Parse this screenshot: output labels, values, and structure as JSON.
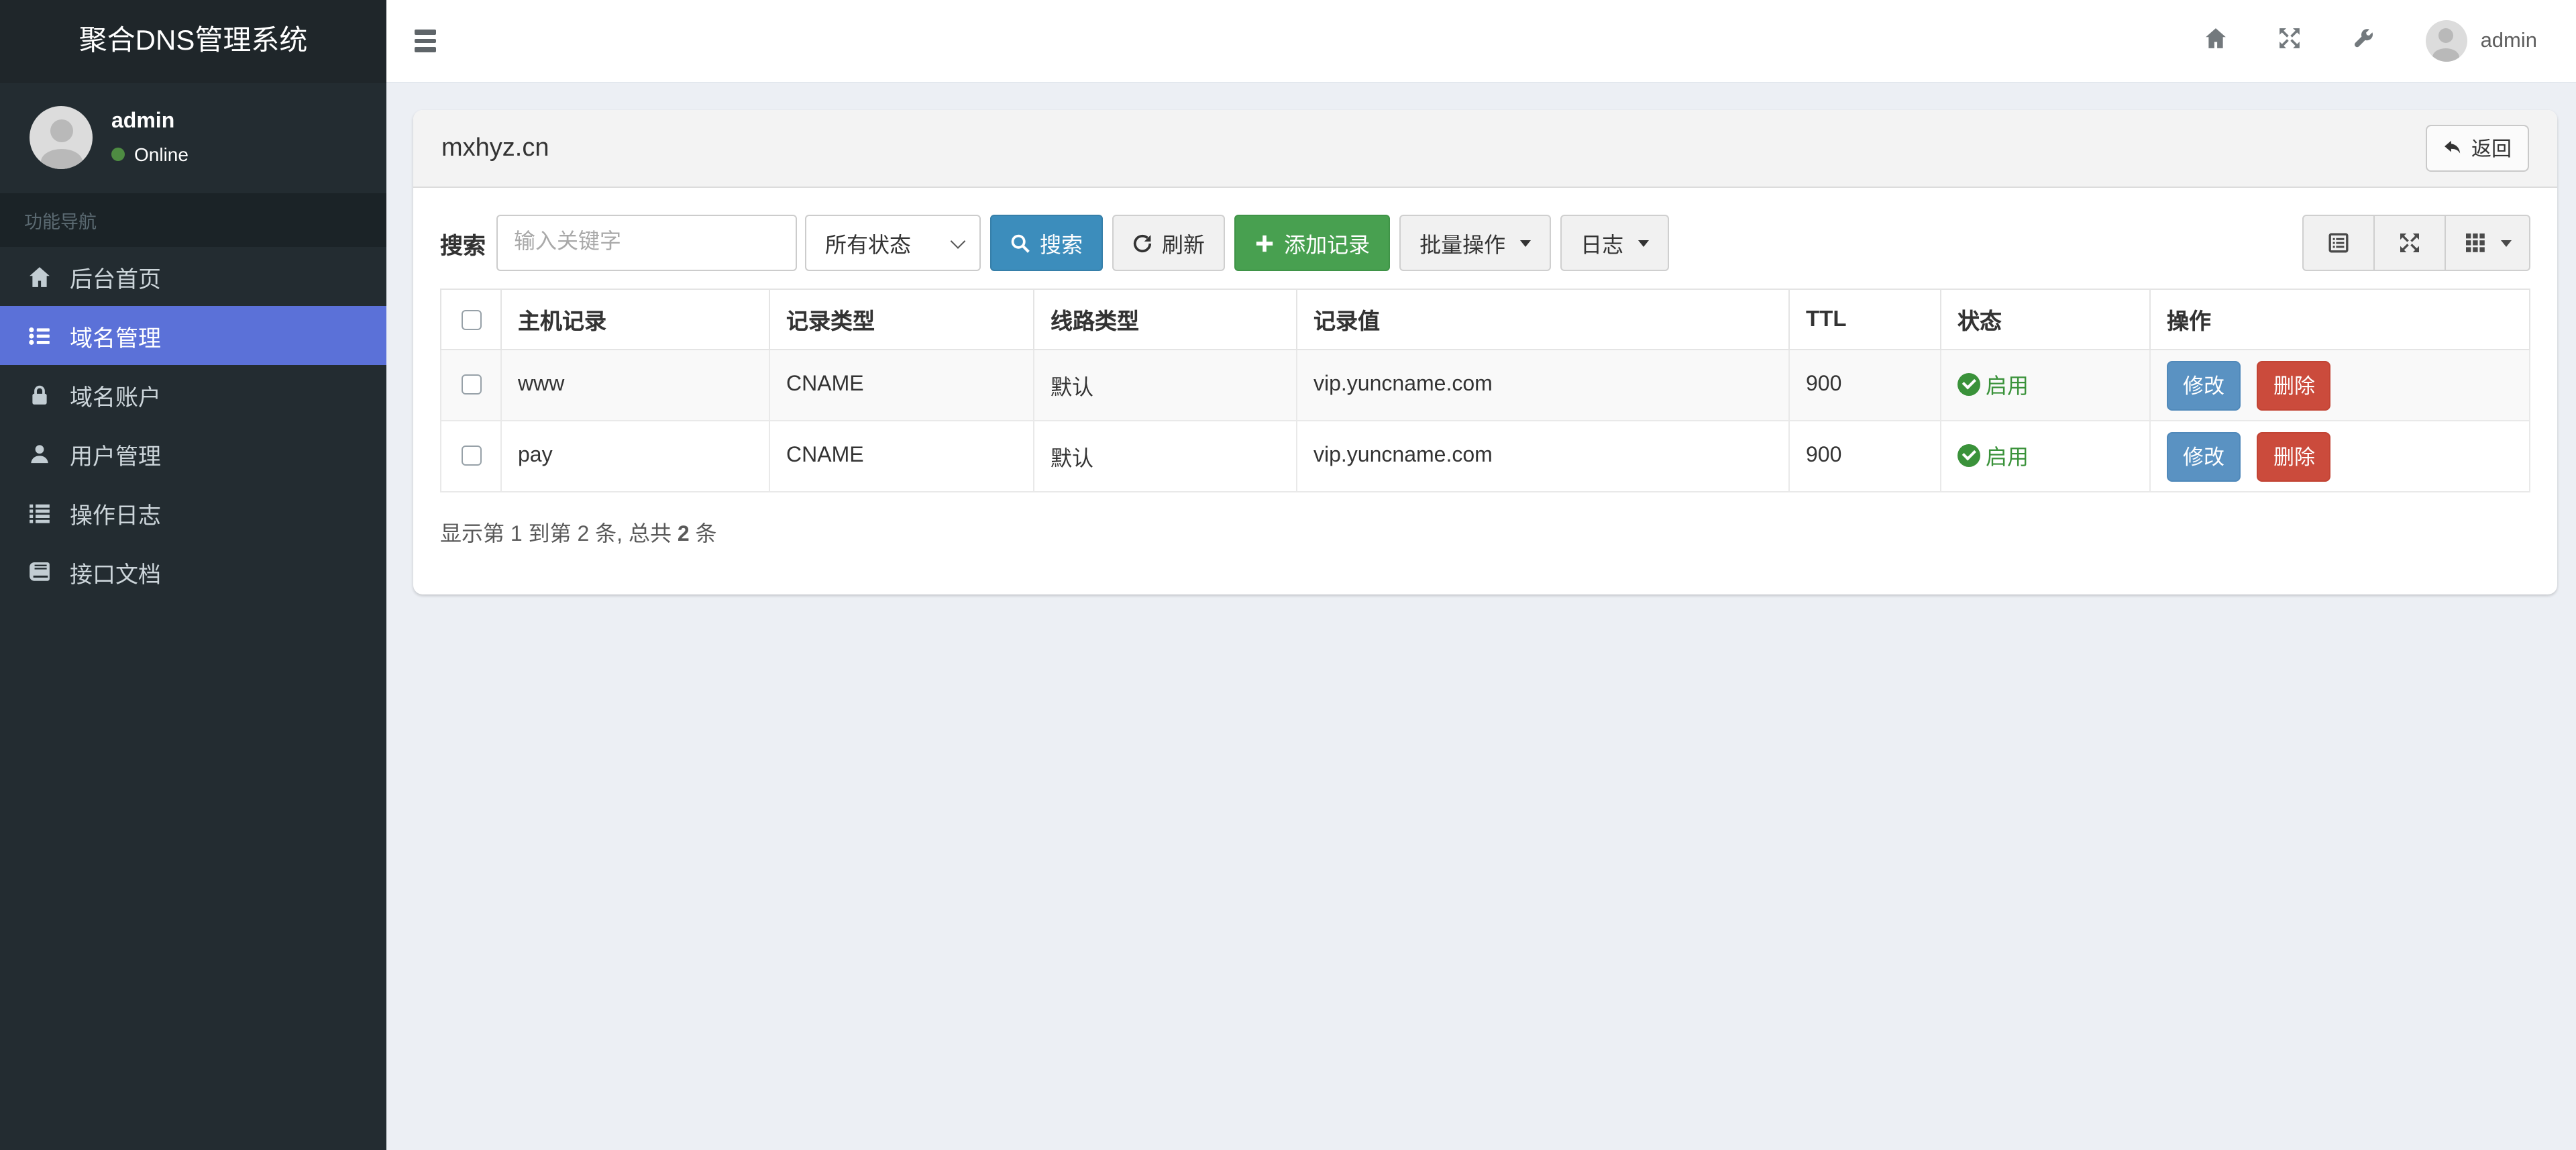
{
  "app": {
    "title": "聚合DNS管理系统"
  },
  "navbar": {
    "username": "admin",
    "icons": [
      "menu-icon",
      "home-icon",
      "fullscreen-icon",
      "wrench-icon",
      "user-avatar"
    ]
  },
  "sidebar": {
    "user": {
      "name": "admin",
      "status": "Online"
    },
    "section_header": "功能导航",
    "items": [
      {
        "label": "后台首页",
        "icon": "home-icon",
        "active": false
      },
      {
        "label": "域名管理",
        "icon": "th-list-icon",
        "active": true
      },
      {
        "label": "域名账户",
        "icon": "lock-icon",
        "active": false
      },
      {
        "label": "用户管理",
        "icon": "user-icon",
        "active": false
      },
      {
        "label": "操作日志",
        "icon": "log-list-icon",
        "active": false
      },
      {
        "label": "接口文档",
        "icon": "book-icon",
        "active": false
      }
    ]
  },
  "page": {
    "panel_title": "mxhyz.cn",
    "back_button": "返回"
  },
  "toolbar": {
    "search_label": "搜索",
    "keyword_placeholder": "输入关键字",
    "status_filter_value": "所有状态",
    "search_button": "搜索",
    "refresh_button": "刷新",
    "add_record_button": "添加记录",
    "batch_button": "批量操作",
    "log_button": "日志",
    "view_icons": [
      "detail-view-icon",
      "fullscreen-icon",
      "columns-grid-icon"
    ]
  },
  "table": {
    "columns": [
      "主机记录",
      "记录类型",
      "线路类型",
      "记录值",
      "TTL",
      "状态",
      "操作"
    ],
    "rows": [
      {
        "host": "www",
        "type": "CNAME",
        "line": "默认",
        "value": "vip.yuncname.com",
        "ttl": "900",
        "status": "启用"
      },
      {
        "host": "pay",
        "type": "CNAME",
        "line": "默认",
        "value": "vip.yuncname.com",
        "ttl": "900",
        "status": "启用"
      }
    ],
    "actions": {
      "edit": "修改",
      "delete": "删除"
    }
  },
  "summary": {
    "before": "显示第 1 到第 2 条, 总共 ",
    "total": "2",
    "after": " 条"
  },
  "colors": {
    "sidebar_bg": "#232c31",
    "sidebar_active": "#5b71d8",
    "primary_button": "#3c8dbc",
    "success_button": "#48a050",
    "edit_button": "#5a92c2",
    "delete_button": "#cb4b3c",
    "status_enabled": "#3a923a",
    "content_bg": "#eceff4"
  }
}
